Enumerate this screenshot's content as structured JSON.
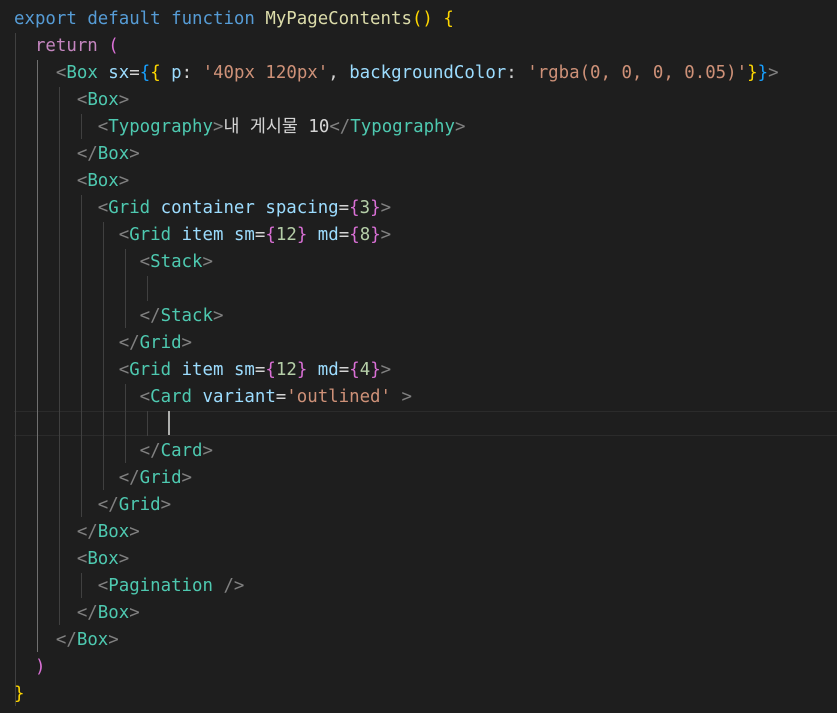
{
  "editor": {
    "lines": [
      [
        {
          "t": "export",
          "c": "kw"
        },
        {
          "t": " "
        },
        {
          "t": "default",
          "c": "kw"
        },
        {
          "t": " "
        },
        {
          "t": "function",
          "c": "kw"
        },
        {
          "t": " "
        },
        {
          "t": "MyPageContents",
          "c": "fn"
        },
        {
          "t": "()",
          "c": "b1"
        },
        {
          "t": " "
        },
        {
          "t": "{",
          "c": "b1"
        }
      ],
      [
        {
          "t": "  "
        },
        {
          "t": "return",
          "c": "ctrl"
        },
        {
          "t": " "
        },
        {
          "t": "(",
          "c": "b2"
        }
      ],
      [
        {
          "t": "    "
        },
        {
          "t": "<",
          "c": "punc"
        },
        {
          "t": "Box",
          "c": "tag"
        },
        {
          "t": " "
        },
        {
          "t": "sx",
          "c": "attr"
        },
        {
          "t": "="
        },
        {
          "t": "{",
          "c": "b3"
        },
        {
          "t": "{",
          "c": "b1"
        },
        {
          "t": " "
        },
        {
          "t": "p",
          "c": "attr"
        },
        {
          "t": ": "
        },
        {
          "t": "'40px 120px'",
          "c": "str"
        },
        {
          "t": ", "
        },
        {
          "t": "backgroundColor",
          "c": "attr"
        },
        {
          "t": ": "
        },
        {
          "t": "'rgba(0, 0, 0, 0.05)'",
          "c": "str"
        },
        {
          "t": "}",
          "c": "b1"
        },
        {
          "t": "}",
          "c": "b3"
        },
        {
          "t": ">",
          "c": "punc"
        }
      ],
      [
        {
          "t": "      "
        },
        {
          "t": "<",
          "c": "punc"
        },
        {
          "t": "Box",
          "c": "tag"
        },
        {
          "t": ">",
          "c": "punc"
        }
      ],
      [
        {
          "t": "        "
        },
        {
          "t": "<",
          "c": "punc"
        },
        {
          "t": "Typography",
          "c": "tag"
        },
        {
          "t": ">",
          "c": "punc"
        },
        {
          "t": "내 게시물 10",
          "c": "txt"
        },
        {
          "t": "</",
          "c": "punc"
        },
        {
          "t": "Typography",
          "c": "tag"
        },
        {
          "t": ">",
          "c": "punc"
        }
      ],
      [
        {
          "t": "      "
        },
        {
          "t": "</",
          "c": "punc"
        },
        {
          "t": "Box",
          "c": "tag"
        },
        {
          "t": ">",
          "c": "punc"
        }
      ],
      [
        {
          "t": "      "
        },
        {
          "t": "<",
          "c": "punc"
        },
        {
          "t": "Box",
          "c": "tag"
        },
        {
          "t": ">",
          "c": "punc"
        }
      ],
      [
        {
          "t": "        "
        },
        {
          "t": "<",
          "c": "punc"
        },
        {
          "t": "Grid",
          "c": "tag"
        },
        {
          "t": " "
        },
        {
          "t": "container",
          "c": "attr"
        },
        {
          "t": " "
        },
        {
          "t": "spacing",
          "c": "attr"
        },
        {
          "t": "="
        },
        {
          "t": "{",
          "c": "b2"
        },
        {
          "t": "3",
          "c": "num"
        },
        {
          "t": "}",
          "c": "b2"
        },
        {
          "t": ">",
          "c": "punc"
        }
      ],
      [
        {
          "t": "          "
        },
        {
          "t": "<",
          "c": "punc"
        },
        {
          "t": "Grid",
          "c": "tag"
        },
        {
          "t": " "
        },
        {
          "t": "item",
          "c": "attr"
        },
        {
          "t": " "
        },
        {
          "t": "sm",
          "c": "attr"
        },
        {
          "t": "="
        },
        {
          "t": "{",
          "c": "b2"
        },
        {
          "t": "12",
          "c": "num"
        },
        {
          "t": "}",
          "c": "b2"
        },
        {
          "t": " "
        },
        {
          "t": "md",
          "c": "attr"
        },
        {
          "t": "="
        },
        {
          "t": "{",
          "c": "b2"
        },
        {
          "t": "8",
          "c": "num"
        },
        {
          "t": "}",
          "c": "b2"
        },
        {
          "t": ">",
          "c": "punc"
        }
      ],
      [
        {
          "t": "            "
        },
        {
          "t": "<",
          "c": "punc"
        },
        {
          "t": "Stack",
          "c": "tag"
        },
        {
          "t": ">",
          "c": "punc"
        }
      ],
      [
        {
          "t": ""
        }
      ],
      [
        {
          "t": "            "
        },
        {
          "t": "</",
          "c": "punc"
        },
        {
          "t": "Stack",
          "c": "tag"
        },
        {
          "t": ">",
          "c": "punc"
        }
      ],
      [
        {
          "t": "          "
        },
        {
          "t": "</",
          "c": "punc"
        },
        {
          "t": "Grid",
          "c": "tag"
        },
        {
          "t": ">",
          "c": "punc"
        }
      ],
      [
        {
          "t": "          "
        },
        {
          "t": "<",
          "c": "punc"
        },
        {
          "t": "Grid",
          "c": "tag"
        },
        {
          "t": " "
        },
        {
          "t": "item",
          "c": "attr"
        },
        {
          "t": " "
        },
        {
          "t": "sm",
          "c": "attr"
        },
        {
          "t": "="
        },
        {
          "t": "{",
          "c": "b2"
        },
        {
          "t": "12",
          "c": "num"
        },
        {
          "t": "}",
          "c": "b2"
        },
        {
          "t": " "
        },
        {
          "t": "md",
          "c": "attr"
        },
        {
          "t": "="
        },
        {
          "t": "{",
          "c": "b2"
        },
        {
          "t": "4",
          "c": "num"
        },
        {
          "t": "}",
          "c": "b2"
        },
        {
          "t": ">",
          "c": "punc"
        }
      ],
      [
        {
          "t": "            "
        },
        {
          "t": "<",
          "c": "punc"
        },
        {
          "t": "Card",
          "c": "tag"
        },
        {
          "t": " "
        },
        {
          "t": "variant",
          "c": "attr"
        },
        {
          "t": "="
        },
        {
          "t": "'outlined'",
          "c": "str"
        },
        {
          "t": " "
        },
        {
          "t": ">",
          "c": "punc"
        }
      ],
      [
        {
          "t": ""
        }
      ],
      [
        {
          "t": "            "
        },
        {
          "t": "</",
          "c": "punc"
        },
        {
          "t": "Card",
          "c": "tag"
        },
        {
          "t": ">",
          "c": "punc"
        }
      ],
      [
        {
          "t": "          "
        },
        {
          "t": "</",
          "c": "punc"
        },
        {
          "t": "Grid",
          "c": "tag"
        },
        {
          "t": ">",
          "c": "punc"
        }
      ],
      [
        {
          "t": "        "
        },
        {
          "t": "</",
          "c": "punc"
        },
        {
          "t": "Grid",
          "c": "tag"
        },
        {
          "t": ">",
          "c": "punc"
        }
      ],
      [
        {
          "t": "      "
        },
        {
          "t": "</",
          "c": "punc"
        },
        {
          "t": "Box",
          "c": "tag"
        },
        {
          "t": ">",
          "c": "punc"
        }
      ],
      [
        {
          "t": "      "
        },
        {
          "t": "<",
          "c": "punc"
        },
        {
          "t": "Box",
          "c": "tag"
        },
        {
          "t": ">",
          "c": "punc"
        }
      ],
      [
        {
          "t": "        "
        },
        {
          "t": "<",
          "c": "punc"
        },
        {
          "t": "Pagination",
          "c": "tag"
        },
        {
          "t": " "
        },
        {
          "t": "/>",
          "c": "punc"
        }
      ],
      [
        {
          "t": "      "
        },
        {
          "t": "</",
          "c": "punc"
        },
        {
          "t": "Box",
          "c": "tag"
        },
        {
          "t": ">",
          "c": "punc"
        }
      ],
      [
        {
          "t": "    "
        },
        {
          "t": "</",
          "c": "punc"
        },
        {
          "t": "Box",
          "c": "tag"
        },
        {
          "t": ">",
          "c": "punc"
        }
      ],
      [
        {
          "t": "  "
        },
        {
          "t": ")",
          "c": "b2"
        }
      ],
      [
        {
          "t": "}",
          "c": "b1"
        }
      ]
    ],
    "colors": {
      "background": "#1e1e1e",
      "keyword": "#569cd6",
      "control": "#c586c0",
      "function": "#dcdcaa",
      "tag": "#4ec9b0",
      "attribute": "#9cdcfe",
      "string": "#ce9178",
      "number": "#b5cea8",
      "punctuation": "#808080",
      "bracket_gold": "#ffd700",
      "bracket_orchid": "#da70d6",
      "bracket_blue": "#179fff"
    }
  }
}
